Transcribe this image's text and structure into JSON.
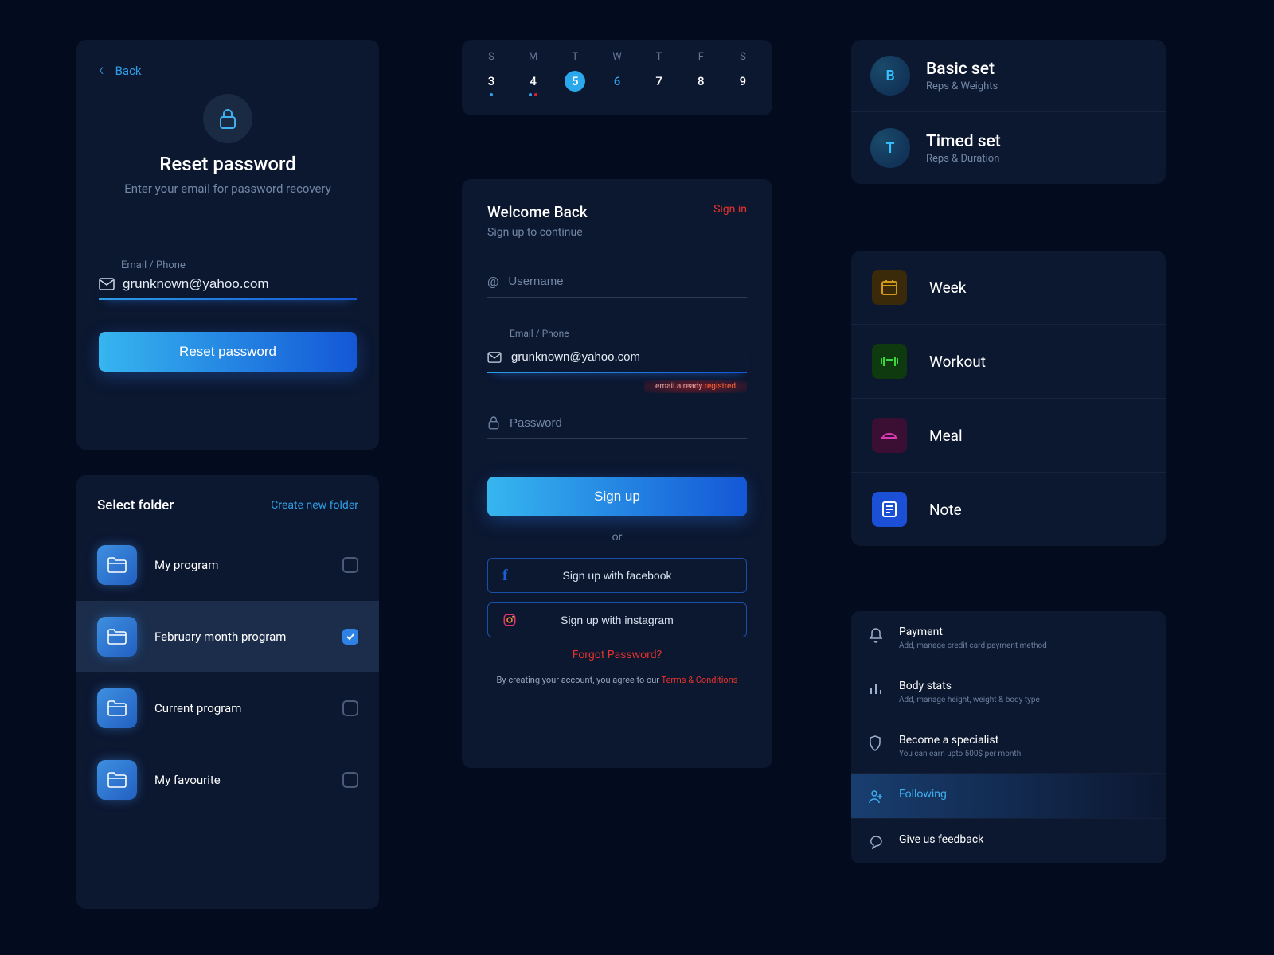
{
  "reset": {
    "back": "Back",
    "title": "Reset password",
    "subtitle": "Enter your email for password recovery",
    "field_label": "Email / Phone",
    "email_value": "grunknown@yahoo.com",
    "button": "Reset password"
  },
  "folders": {
    "title": "Select folder",
    "action": "Create new folder",
    "items": [
      {
        "name": "My program",
        "checked": false
      },
      {
        "name": "February month program",
        "checked": true
      },
      {
        "name": "Current program",
        "checked": false
      },
      {
        "name": "My favourite",
        "checked": false
      }
    ]
  },
  "calendar": {
    "days": [
      "S",
      "M",
      "T",
      "W",
      "T",
      "F",
      "S"
    ],
    "dates": [
      "3",
      "4",
      "5",
      "6",
      "7",
      "8",
      "9"
    ],
    "selected_index": 2,
    "link_index": 3
  },
  "signup": {
    "welcome": "Welcome Back",
    "subtitle": "Sign up to continue",
    "signin": "Sign in",
    "username_ph": "Username",
    "email_label": "Email / Phone",
    "email_value": "grunknown@yahoo.com",
    "error_prefix": "email already ",
    "error_word": "registred",
    "password_ph": "Password",
    "signup_btn": "Sign up",
    "or": "or",
    "fb": "Sign up with facebook",
    "ig": "Sign up with instagram",
    "forgot": "Forgot Password?",
    "terms_pre": "By creating your account, you agree to our ",
    "terms_link": "Terms & Conditions"
  },
  "sets": [
    {
      "letter": "B",
      "title": "Basic set",
      "sub": "Reps & Weights"
    },
    {
      "letter": "T",
      "title": "Timed set",
      "sub": "Reps & Duration"
    }
  ],
  "categories": [
    {
      "label": "Week",
      "color": "#d19a1a",
      "bg": "#3a2a0a"
    },
    {
      "label": "Workout",
      "color": "#3bd83b",
      "bg": "#0f3a0f"
    },
    {
      "label": "Meal",
      "color": "#d83bb0",
      "bg": "#3a0f33"
    },
    {
      "label": "Note",
      "color": "#ffffff",
      "bg": "#1a4fd6"
    }
  ],
  "settings": [
    {
      "title": "Payment",
      "sub": "Add, manage credit card payment method",
      "icon": "bell"
    },
    {
      "title": "Body stats",
      "sub": "Add, manage height, weight & body type",
      "icon": "bars"
    },
    {
      "title": "Become a specialist",
      "sub": "You can earn upto 500$ per month",
      "icon": "shield"
    },
    {
      "title": "Following",
      "sub": "",
      "icon": "user",
      "active": true
    },
    {
      "title": "Give us feedback",
      "sub": "",
      "icon": "chat"
    }
  ]
}
